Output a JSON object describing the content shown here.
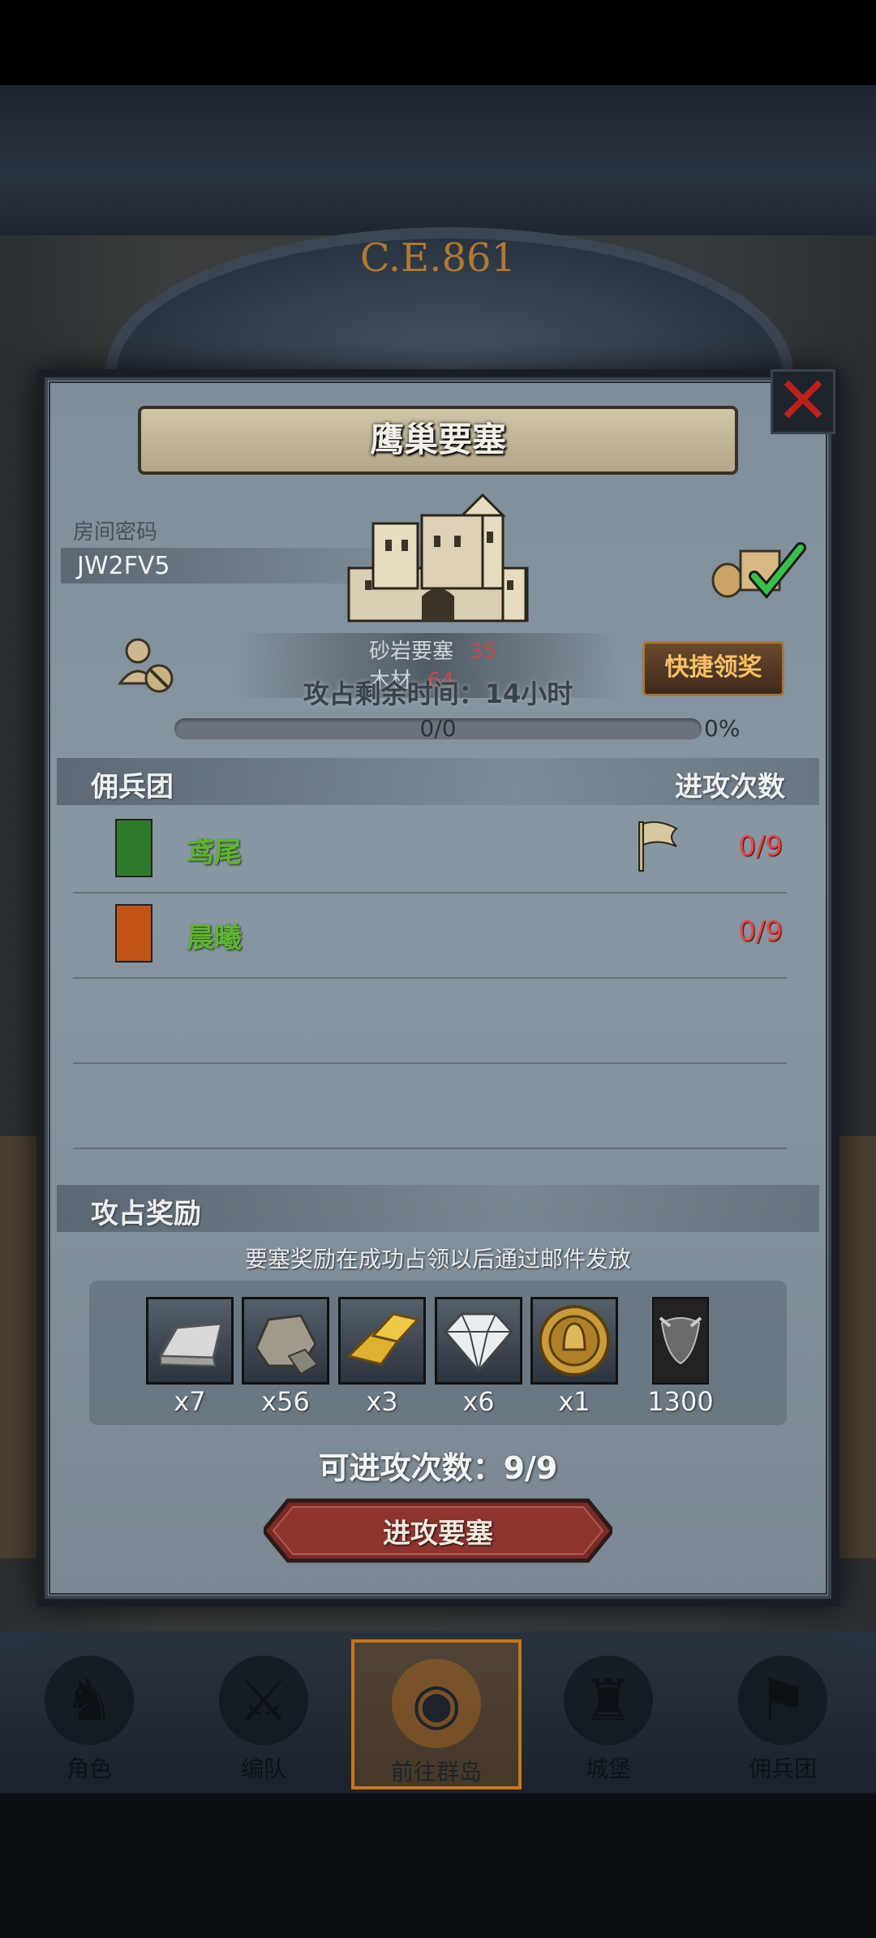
{
  "background": {
    "era_label": "C.E.861"
  },
  "dialog": {
    "title": "鹰巢要塞",
    "room_code_label": "房间密码",
    "room_code": "JW2FV5",
    "resources": [
      {
        "name": "砂岩要塞",
        "value": "35"
      },
      {
        "name": "木材",
        "value": "64"
      }
    ],
    "quick_claim_label": "快捷领奖",
    "timer_text": "攻占剩余时间：14小时",
    "progress": {
      "text": "0/0",
      "percent_text": "0%",
      "fraction": 0
    },
    "mercenary_header": {
      "title": "佣兵团",
      "column_label": "进攻次数"
    },
    "mercenaries": [
      {
        "name": "鸢尾",
        "count": "0/9",
        "banner_color": "#2f7a2a"
      },
      {
        "name": "晨曦",
        "count": "0/9",
        "banner_color": "#c25418"
      }
    ],
    "reward_header": "攻占奖励",
    "reward_note": "要塞奖励在成功占领以后通过邮件发放",
    "rewards": [
      {
        "icon": "silver-ingot-icon",
        "qty": "x7"
      },
      {
        "icon": "stone-ore-icon",
        "qty": "x56"
      },
      {
        "icon": "gold-bars-icon",
        "qty": "x3"
      },
      {
        "icon": "diamond-icon",
        "qty": "x6"
      },
      {
        "icon": "knight-coin-icon",
        "qty": "x1"
      },
      {
        "icon": "bull-banner-icon",
        "qty": "1300"
      }
    ],
    "attempts_text": "可进攻次数：9/9",
    "attack_button_label": "进攻要塞"
  },
  "nav": {
    "items": [
      {
        "label": "角色",
        "icon": "character-icon"
      },
      {
        "label": "编队",
        "icon": "formation-icon"
      },
      {
        "label": "前往群岛",
        "icon": "islands-icon",
        "active": true
      },
      {
        "label": "城堡",
        "icon": "castle-icon"
      },
      {
        "label": "佣兵团",
        "icon": "mercenary-icon"
      }
    ]
  },
  "colors": {
    "accent_orange": "#c8761c",
    "team_name_green": "#5fb432",
    "count_red": "#e34848",
    "close_red": "#c0201c"
  }
}
